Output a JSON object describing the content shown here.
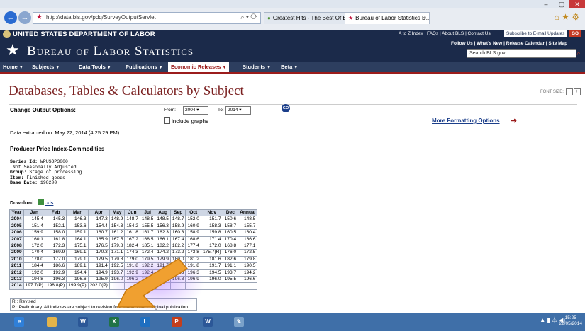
{
  "browser": {
    "url": "http://data.bls.gov/pdq/SurveyOutputServlet",
    "tabs": [
      {
        "label": "Greatest Hits - The Best Of Bru..."
      },
      {
        "label": "Bureau of Labor Statistics D..."
      }
    ],
    "window_controls": {
      "minimize": "–",
      "maximize": "▢",
      "close": "✕"
    }
  },
  "header": {
    "department": "UNITED STATES DEPARTMENT OF LABOR",
    "utility_links": "A to Z Index | FAQs | About BLS | Contact Us",
    "subscribe_label": "Subscribe to E-mail Updates",
    "go_label": "GO",
    "agency": "Bureau of Labor Statistics",
    "follow_links": "Follow Us  | What's New | Release Calendar | Site Map",
    "search_placeholder": "Search BLS.gov"
  },
  "nav": {
    "items": [
      {
        "label": "Home"
      },
      {
        "label": "Subjects"
      },
      {
        "label": "Data Tools"
      },
      {
        "label": "Publications"
      },
      {
        "label": "Economic Releases"
      },
      {
        "label": "Students"
      },
      {
        "label": "Beta"
      }
    ],
    "active": "Economic Releases"
  },
  "page": {
    "title": "Databases, Tables & Calculators by Subject",
    "font_size_label": "FONT SIZE:",
    "change_output": "Change Output Options:",
    "from_label": "From:",
    "from_value": "2004",
    "to_label": "To:",
    "to_value": "2014",
    "go_circle": "GO",
    "include_graphs": "include graphs",
    "more_formatting": "More Formatting Options",
    "extracted": "Data extracted on: May 22, 2014 (4:25:29 PM)",
    "series_heading": "Producer Price Index-Commodities",
    "series_info": [
      {
        "key": "Series Id:",
        "value": "WPUSOP3000"
      },
      {
        "key": "",
        "value": "Not Seasonally Adjusted"
      },
      {
        "key": "Group:",
        "value": "Stage of processing"
      },
      {
        "key": "Item:",
        "value": "Finished goods"
      },
      {
        "key": "Base Date:",
        "value": "198200"
      }
    ],
    "download_label": "Download:",
    "download_link": ".xls"
  },
  "table": {
    "headers": [
      "Year",
      "Jan",
      "Feb",
      "Mar",
      "Apr",
      "May",
      "Jun",
      "Jul",
      "Aug",
      "Sep",
      "Oct",
      "Nov",
      "Dec",
      "Annual"
    ],
    "rows": [
      [
        "2004",
        "145.4",
        "145.3",
        "146.3",
        "147.3",
        "148.9",
        "148.7",
        "148.5",
        "148.5",
        "148.7",
        "152.0",
        "151.7",
        "150.6",
        "148.5"
      ],
      [
        "2005",
        "151.4",
        "152.1",
        "153.6",
        "154.4",
        "154.3",
        "154.2",
        "155.5",
        "156.3",
        "158.9",
        "160.9",
        "158.3",
        "158.7",
        "155.7"
      ],
      [
        "2006",
        "159.9",
        "158.0",
        "159.1",
        "160.7",
        "161.2",
        "161.8",
        "161.7",
        "162.3",
        "160.3",
        "158.9",
        "159.8",
        "160.5",
        "160.4"
      ],
      [
        "2007",
        "160.1",
        "161.8",
        "164.1",
        "165.9",
        "167.5",
        "167.2",
        "168.5",
        "166.1",
        "167.4",
        "168.6",
        "171.4",
        "170.4",
        "166.6"
      ],
      [
        "2008",
        "172.0",
        "172.3",
        "175.1",
        "176.5",
        "179.8",
        "182.4",
        "185.1",
        "182.2",
        "182.2",
        "177.4",
        "172.0",
        "168.8",
        "177.1"
      ],
      [
        "2009",
        "170.4",
        "169.9",
        "169.1",
        "170.3",
        "171.1",
        "174.3",
        "172.4",
        "174.2",
        "173.2",
        "173.8",
        "175.7(R)",
        "176.0",
        "172.5"
      ],
      [
        "2010",
        "178.0",
        "177.0",
        "179.1",
        "179.5",
        "179.8",
        "179.0",
        "179.5",
        "179.9",
        "180.0",
        "181.2",
        "181.6",
        "182.6",
        "179.8"
      ],
      [
        "2011",
        "184.4",
        "186.6",
        "189.1",
        "191.4",
        "192.5",
        "191.8",
        "192.2",
        "191.7",
        "192.6",
        "191.8",
        "191.7",
        "191.1",
        "190.5"
      ],
      [
        "2012",
        "192.0",
        "192.9",
        "194.4",
        "194.9",
        "193.7",
        "192.9",
        "192.4",
        "193.7",
        "195.3",
        "196.3",
        "194.5",
        "193.7",
        "194.2"
      ],
      [
        "2013",
        "194.8",
        "196.3",
        "196.6",
        "195.9",
        "196.0",
        "196.2",
        "196.5",
        "196.2",
        "196.3",
        "196.9",
        "196.0",
        "195.5",
        "196.6"
      ],
      [
        "2014",
        "197.7(P)",
        "198.8(P)",
        "199.9(P)",
        "202.0(P)",
        "",
        "",
        "",
        "",
        "",
        "",
        "",
        "",
        ""
      ]
    ],
    "footnotes": [
      "R : Revised",
      "P : Preliminary. All indexes are subject to revision four months after original publication."
    ]
  },
  "taskbar": {
    "clock_time": "15:25",
    "clock_date": "22/05/2014"
  },
  "colors": {
    "bls_navy": "#1b2a4a",
    "accent_red": "#9b1c1c",
    "highlight_arrow": "#f0a030"
  }
}
